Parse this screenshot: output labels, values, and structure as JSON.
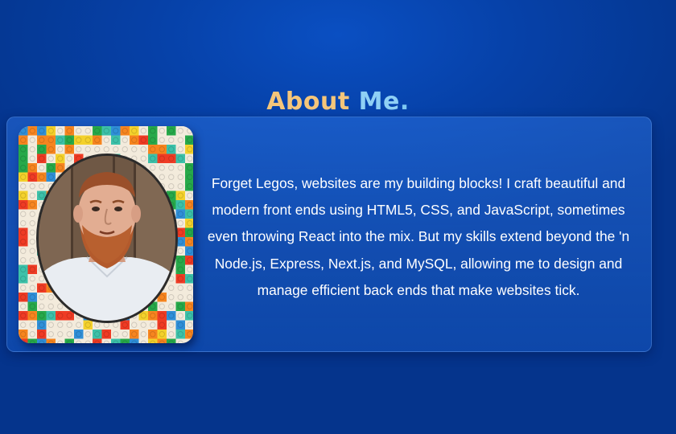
{
  "about": {
    "title_part1": "About",
    "title_part2": "Me",
    "title_dot": ".",
    "paragraph": "Forget Legos, websites are my building blocks! I craft beautiful and modern front ends using HTML5, CSS, and JavaScript, sometimes even throwing React into the mix. But my skills extend beyond the 'n Node.js, Express, Next.js, and MySQL, allowing me to design and manage efficient back ends that make websites tick."
  },
  "colors": {
    "background": "#0641a8",
    "title_about": "#f5c67a",
    "title_me": "#8fd0f5",
    "text": "#ffffff"
  }
}
